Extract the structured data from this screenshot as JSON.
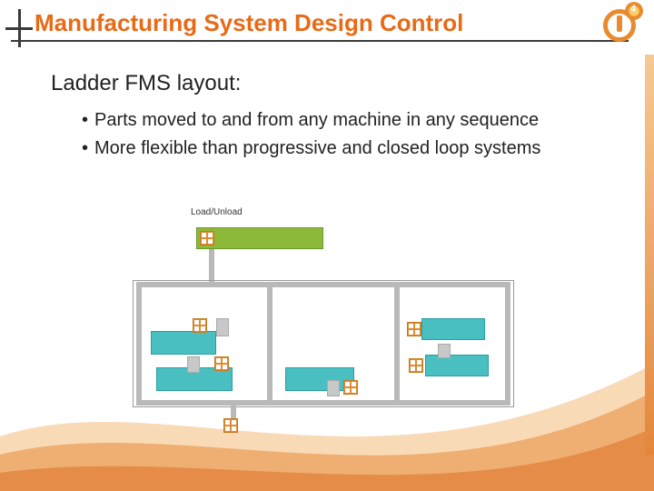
{
  "logo": {
    "badge": "4"
  },
  "title": "Manufacturing System Design Control",
  "subtitle": "Ladder FMS layout:",
  "bullets": [
    "Parts moved to and from any machine in any sequence",
    "More flexible than progressive and closed loop systems"
  ],
  "caption": "Load/Unload"
}
